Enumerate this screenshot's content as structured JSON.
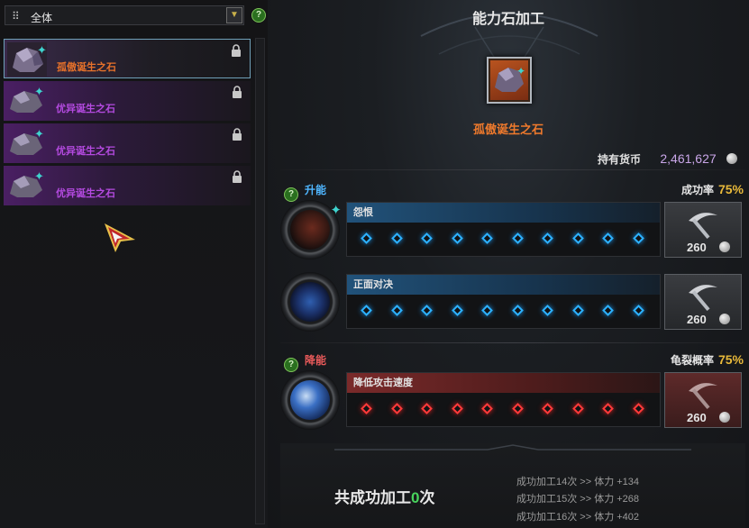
{
  "filter": {
    "label": "全体",
    "grid_icon": "⠿",
    "dropdown_icon": "chevron-down"
  },
  "filter_help": "?",
  "inventory": [
    {
      "name": "孤傲诞生之石",
      "color": "#e8722a",
      "selected": true
    },
    {
      "name": "优异诞生之石",
      "color": "#b44ae0",
      "selected": false
    },
    {
      "name": "优异诞生之石",
      "color": "#b44ae0",
      "selected": false
    },
    {
      "name": "优异诞生之石",
      "color": "#b44ae0",
      "selected": false
    }
  ],
  "panel": {
    "title": "能力石加工",
    "selected_stone": "孤傲诞生之石",
    "currency_label": "持有货币",
    "currency_value": "2,461,627"
  },
  "boost": {
    "help": "?",
    "label": "升能",
    "rate_label": "成功率",
    "rate_value": "75%",
    "rows": [
      {
        "name": "怨恨",
        "cost": "260",
        "filled": 0,
        "total": 10
      },
      {
        "name": "正面对决",
        "cost": "260",
        "filled": 0,
        "total": 10
      }
    ]
  },
  "reduce": {
    "help": "?",
    "label": "降能",
    "rate_label": "龟裂概率",
    "rate_value": "75%",
    "rows": [
      {
        "name": "降低攻击速度",
        "cost": "260",
        "filled": 0,
        "total": 10
      }
    ]
  },
  "summary": {
    "prefix": "共成功加工",
    "count": "0",
    "suffix": "次",
    "log": [
      "成功加工14次 >> 体力 +134",
      "成功加工15次 >> 体力 +268",
      "成功加工16次 >> 体力 +402"
    ]
  },
  "colors": {
    "accent_gold": "#e8b93a",
    "boost_blue": "#2db2ff",
    "reduce_red": "#ff3a3a",
    "success_green": "#48d35c"
  }
}
